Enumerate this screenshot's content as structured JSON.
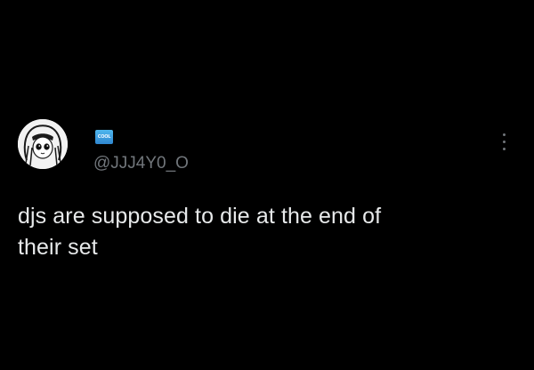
{
  "tweet": {
    "avatar_icon": "avatar-drawing-icon",
    "badge_icon": "cool-badge-icon",
    "badge_text": "COOL",
    "handle": "@JJJ4Y0_O",
    "more_icon": "vertical-ellipsis-icon",
    "text_line_1": "djs are supposed to die at the end of",
    "text_line_2": "their set"
  },
  "colors": {
    "background": "#000000",
    "text": "#e7e9ea",
    "secondary_text": "#71767b",
    "badge": "#2f86cf"
  }
}
